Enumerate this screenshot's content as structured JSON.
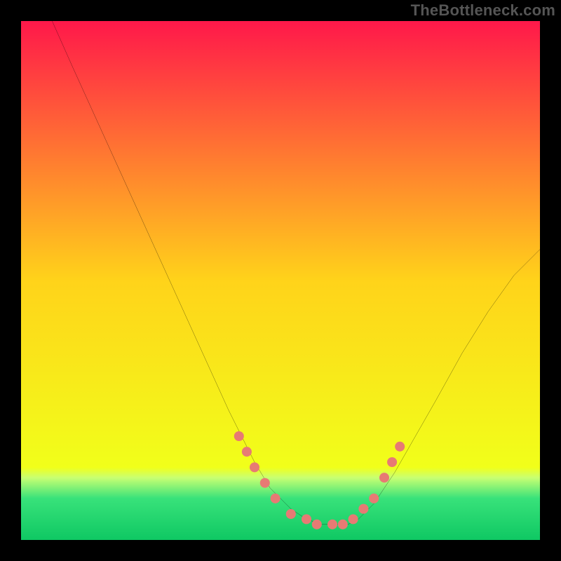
{
  "watermark": "TheBottleneck.com",
  "chart_data": {
    "type": "line",
    "title": "",
    "xlabel": "",
    "ylabel": "",
    "x_range": [
      0,
      100
    ],
    "y_range": [
      0,
      100
    ],
    "axes_visible": false,
    "grid": false,
    "background_gradient": {
      "stops": [
        {
          "offset": 0.0,
          "color": "#ff184a"
        },
        {
          "offset": 0.5,
          "color": "#ffd31a"
        },
        {
          "offset": 0.86,
          "color": "#f1ff1a"
        },
        {
          "offset": 0.88,
          "color": "#c8ff72"
        },
        {
          "offset": 0.92,
          "color": "#38e27a"
        },
        {
          "offset": 1.0,
          "color": "#0fc863"
        }
      ]
    },
    "series": [
      {
        "name": "bottleneck-curve",
        "color": "#000000",
        "stroke_width": 2,
        "x": [
          6,
          10,
          15,
          20,
          25,
          30,
          35,
          40,
          45,
          48,
          52,
          55,
          58,
          60,
          63,
          65,
          68,
          72,
          76,
          80,
          85,
          90,
          95,
          100
        ],
        "y": [
          100,
          91,
          80,
          69,
          58,
          47,
          36,
          25,
          15,
          10,
          6,
          4,
          3,
          3,
          3,
          4,
          7,
          13,
          20,
          27,
          36,
          44,
          51,
          56
        ]
      }
    ],
    "markers": {
      "name": "highlight-dots",
      "color": "#e77a74",
      "radius": 7,
      "points": [
        {
          "x": 42,
          "y": 20
        },
        {
          "x": 43.5,
          "y": 17
        },
        {
          "x": 45,
          "y": 14
        },
        {
          "x": 47,
          "y": 11
        },
        {
          "x": 49,
          "y": 8
        },
        {
          "x": 52,
          "y": 5
        },
        {
          "x": 55,
          "y": 4
        },
        {
          "x": 57,
          "y": 3
        },
        {
          "x": 60,
          "y": 3
        },
        {
          "x": 62,
          "y": 3
        },
        {
          "x": 64,
          "y": 4
        },
        {
          "x": 66,
          "y": 6
        },
        {
          "x": 68,
          "y": 8
        },
        {
          "x": 70,
          "y": 12
        },
        {
          "x": 71.5,
          "y": 15
        },
        {
          "x": 73,
          "y": 18
        }
      ]
    }
  }
}
